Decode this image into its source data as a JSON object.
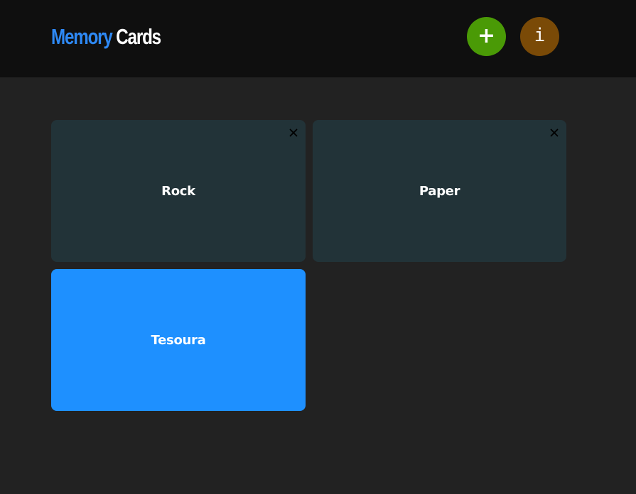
{
  "header": {
    "logo_first": "Memory",
    "logo_second": "Cards",
    "add_button": {
      "label": "+",
      "icon": "plus-icon",
      "color": "#4a9a06"
    },
    "info_button": {
      "label": "i",
      "icon": "info-icon",
      "color": "#7a4a07"
    }
  },
  "colors": {
    "header_bg": "#0f0f0f",
    "page_bg": "#222222",
    "logo_accent": "#2e89f5",
    "card_default": "#223338",
    "card_active": "#1e90ff"
  },
  "cards": [
    {
      "label": "Rock",
      "color": "#223338",
      "close": "×",
      "close_icon": "close-icon"
    },
    {
      "label": "Paper",
      "color": "#223338",
      "close": "×",
      "close_icon": "close-icon"
    },
    {
      "label": "Tesoura",
      "color": "#1e90ff"
    }
  ]
}
